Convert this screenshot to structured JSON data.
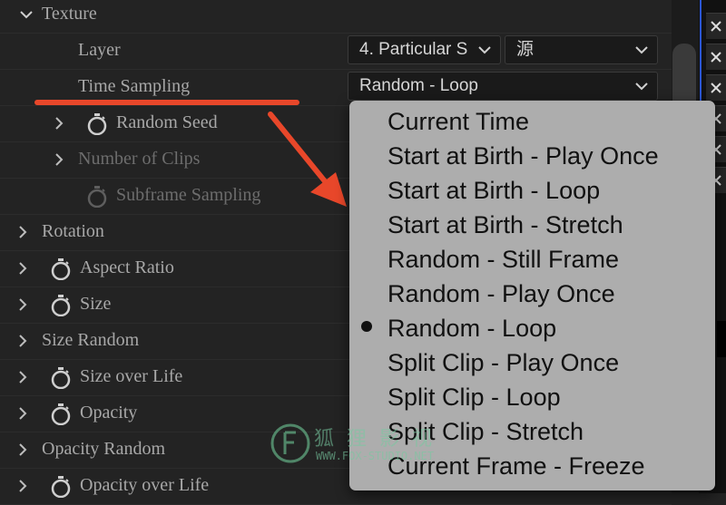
{
  "properties": {
    "texture": "Texture",
    "layer": "Layer",
    "time_sampling": "Time Sampling",
    "random_seed": "Random Seed",
    "number_of_clips": "Number of Clips",
    "subframe_sampling": "Subframe Sampling",
    "rotation": "Rotation",
    "aspect_ratio": "Aspect Ratio",
    "size": "Size",
    "size_random": "Size Random",
    "size_over_life": "Size over Life",
    "opacity": "Opacity",
    "opacity_random": "Opacity Random",
    "opacity_over_life": "Opacity over Life"
  },
  "layer_dropdown": {
    "value": "4. Particular S"
  },
  "source_dropdown": {
    "value": "源"
  },
  "time_sampling_dropdown": {
    "value": "Random - Loop"
  },
  "menu": {
    "items": [
      "Current Time",
      "Start at Birth - Play Once",
      "Start at Birth -  Loop",
      "Start at Birth -  Stretch",
      "Random - Still Frame",
      "Random - Play Once",
      "Random - Loop",
      "Split Clip - Play Once",
      "Split Clip - Loop",
      "Split Clip - Stretch",
      "Current Frame - Freeze"
    ],
    "selected": "Random - Loop"
  },
  "watermark": {
    "text": "狐狸影视",
    "sub": "WWW.FOX-STUDIO.NET"
  },
  "colors": {
    "annotation": "#e8472a",
    "menu_bg": "#adadad",
    "panel_bg": "#232323"
  }
}
